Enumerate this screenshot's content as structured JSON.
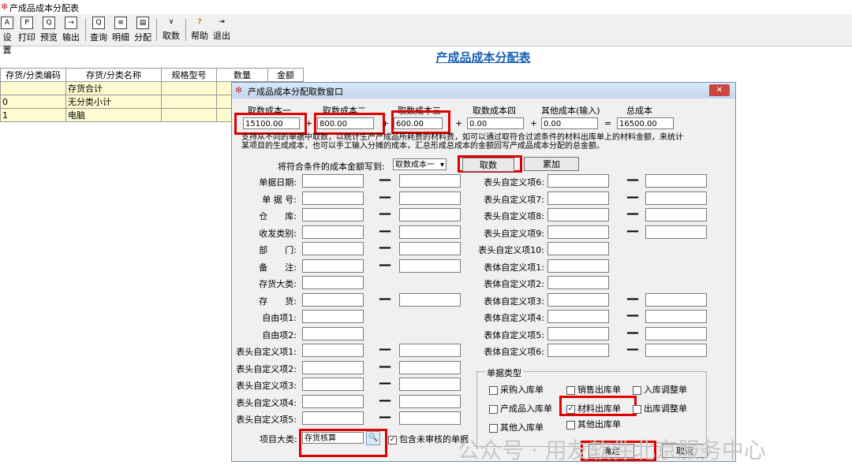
{
  "window_title": "产成品成本分配表",
  "toolbar": [
    {
      "key": "setup",
      "label": "设置",
      "glyph": "A"
    },
    {
      "key": "print",
      "label": "打印",
      "glyph": "P"
    },
    {
      "key": "preview",
      "label": "预览",
      "glyph": "Q"
    },
    {
      "key": "export",
      "label": "输出",
      "glyph": "→"
    },
    {
      "key": "query",
      "label": "查询",
      "glyph": "Q"
    },
    {
      "key": "detail",
      "label": "明细",
      "glyph": "≡"
    },
    {
      "key": "allocate",
      "label": "分配",
      "glyph": "▤"
    },
    {
      "key": "fetch",
      "label": "取数",
      "glyph": "∨"
    },
    {
      "key": "help",
      "label": "帮助",
      "glyph": "?"
    },
    {
      "key": "exit",
      "label": "退出",
      "glyph": "⇥"
    }
  ],
  "report_title": "产成品成本分配表",
  "grid": {
    "headers": [
      "存货/分类编码",
      "存货/分类名称",
      "规格型号",
      "数量",
      "金额"
    ],
    "rows": [
      [
        "",
        "存货合计",
        "",
        "",
        ""
      ],
      [
        "0",
        "无分类小计",
        "",
        "",
        ""
      ],
      [
        "1",
        "电脑",
        "",
        "",
        ""
      ]
    ]
  },
  "dialog": {
    "title": "产成品成本分配取数窗口",
    "cost_labels": [
      "取数成本一",
      "取数成本二",
      "取数成本三",
      "取数成本四",
      "其他成本(输入)",
      "总成本"
    ],
    "cost_values": [
      "15100.00",
      "800.00",
      "600.00",
      "0.00",
      "0.00",
      "16500.00"
    ],
    "plus": "+",
    "equals": "=",
    "desc": "支持从不同的单据中取数，以统计生产产成品所耗费的材料费，如可以通过取符合过滤条件的材料出库单上的材料金额，来统计某项目的生成成本，也可以手工输入分摊的成本，汇总形成总成本的金额回写产成品成本分配的总金额。",
    "write_to_label": "将符合条件的成本金额写到:",
    "write_to_value": "取数成本一",
    "fetch_button": "取数",
    "accumulate_button": "累加",
    "left_fields": [
      "单据日期:",
      "单 据 号:",
      "仓　　库:",
      "收发类别:",
      "部　　门:",
      "备　　注:",
      "存货大类:",
      "存　　货:",
      "自由项1:",
      "自由项2:",
      "表头自定义项1:",
      "表头自定义项2:",
      "表头自定义项3:",
      "表头自定义项4:",
      "表头自定义项5:"
    ],
    "right_fields": [
      "表头自定义项6:",
      "表头自定义项7:",
      "表头自定义项8:",
      "表头自定义项9:",
      "表头自定义项10:",
      "表体自定义项1:",
      "表体自定义项2:",
      "表体自定义项3:",
      "表体自定义项4:",
      "表体自定义项5:",
      "表体自定义项6:"
    ],
    "doc_type_title": "单据类型",
    "doc_types": [
      {
        "label": "采购入库单",
        "checked": false
      },
      {
        "label": "销售出库单",
        "checked": false
      },
      {
        "label": "入库调整单",
        "checked": false
      },
      {
        "label": "产成品入库单",
        "checked": false
      },
      {
        "label": "材料出库单",
        "checked": true
      },
      {
        "label": "出库调整单",
        "checked": false
      },
      {
        "label": "其他入库单",
        "checked": false
      },
      {
        "label": "其他出库单",
        "checked": false
      }
    ],
    "project_label": "项目大类:",
    "project_value": "存货核算",
    "include_unaudited": "包含未审核的单据",
    "ok_button": "确定",
    "cancel_button": "取消"
  },
  "watermark": "公众号 · 用友软件北京服务中心"
}
